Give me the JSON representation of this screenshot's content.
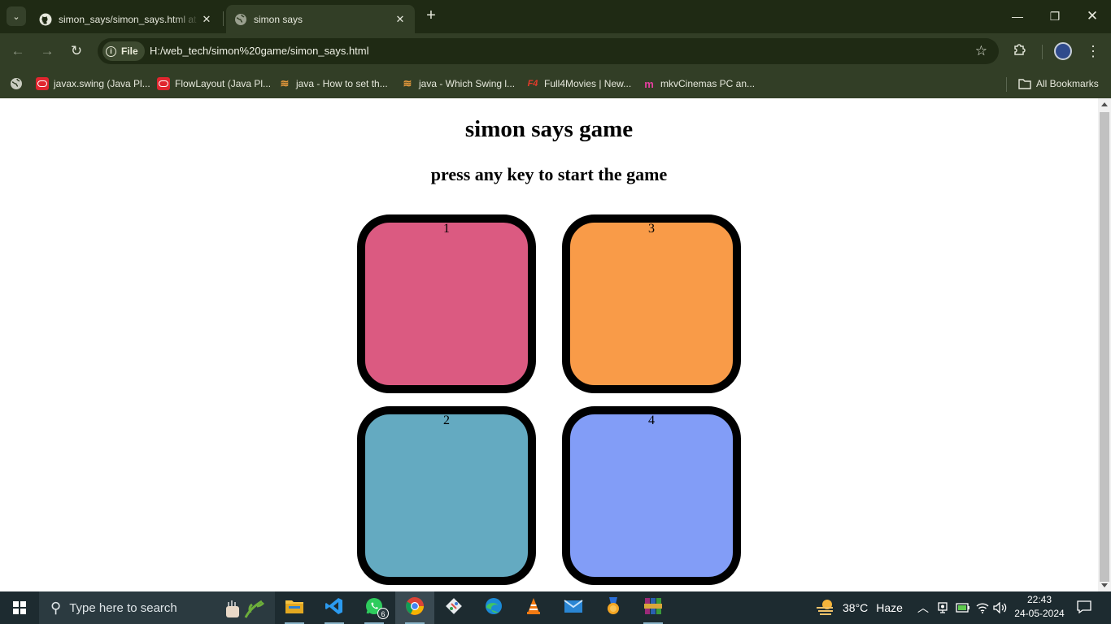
{
  "browser": {
    "tabs": [
      {
        "title": "simon_says/simon_says.html at",
        "active": false,
        "favicon": "github-icon"
      },
      {
        "title": "simon says",
        "active": true,
        "favicon": "globe-icon"
      }
    ],
    "address": {
      "chip_label": "File",
      "url": "H:/web_tech/simon%20game/simon_says.html"
    },
    "bookmarks": [
      {
        "label": "javax.swing (Java Pl...",
        "icon": "oracle-icon"
      },
      {
        "label": "FlowLayout (Java Pl...",
        "icon": "oracle-icon"
      },
      {
        "label": "java - How to set th...",
        "icon": "stackoverflow-icon"
      },
      {
        "label": "java - Which Swing l...",
        "icon": "stackoverflow-icon"
      },
      {
        "label": "Full4Movies | New...",
        "icon": "f4-icon",
        "icon_text": "F4"
      },
      {
        "label": "mkvCinemas PC an...",
        "icon": "mkv-icon",
        "icon_text": "m"
      }
    ],
    "all_bookmarks_label": "All Bookmarks"
  },
  "page": {
    "heading": "simon says game",
    "subheading": "press any key to start the game",
    "buttons": [
      {
        "label": "1",
        "color": "#db5a81"
      },
      {
        "label": "3",
        "color": "#f99b48"
      },
      {
        "label": "2",
        "color": "#64aac1"
      },
      {
        "label": "4",
        "color": "#829df7"
      }
    ]
  },
  "taskbar": {
    "search_placeholder": "Type here to search",
    "apps": [
      "file-explorer-icon",
      "vscode-icon",
      "whatsapp-icon",
      "chrome-icon",
      "git-icon",
      "edge-icon",
      "vlc-icon",
      "mail-icon",
      "app-badge-icon",
      "winrar-icon"
    ],
    "whatsapp_badge": "6",
    "weather": {
      "temp": "38°C",
      "condition": "Haze"
    },
    "time": "22:43",
    "date": "24-05-2024"
  }
}
